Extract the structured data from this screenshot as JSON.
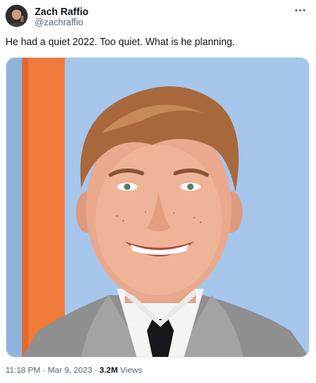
{
  "author": {
    "display_name": "Zach Raffio",
    "handle": "@zachraffio",
    "avatar_icon": "profile-photo"
  },
  "more_icon": "more-horizontal-icon",
  "tweet": {
    "text": "He had a quiet 2022. Too quiet. What is he planning."
  },
  "media": {
    "description_icon": "photo-of-smiling-young-man"
  },
  "meta": {
    "time": "11:18 PM",
    "separator1": " · ",
    "date": "Mar 9, 2023",
    "separator2": " · ",
    "views_count": "3.2M",
    "views_label": " Views"
  },
  "colors": {
    "text_primary": "#0f1419",
    "text_secondary": "#536471",
    "photo_background": "#9cc0e8",
    "accent_stripe": "#f07a3a"
  }
}
